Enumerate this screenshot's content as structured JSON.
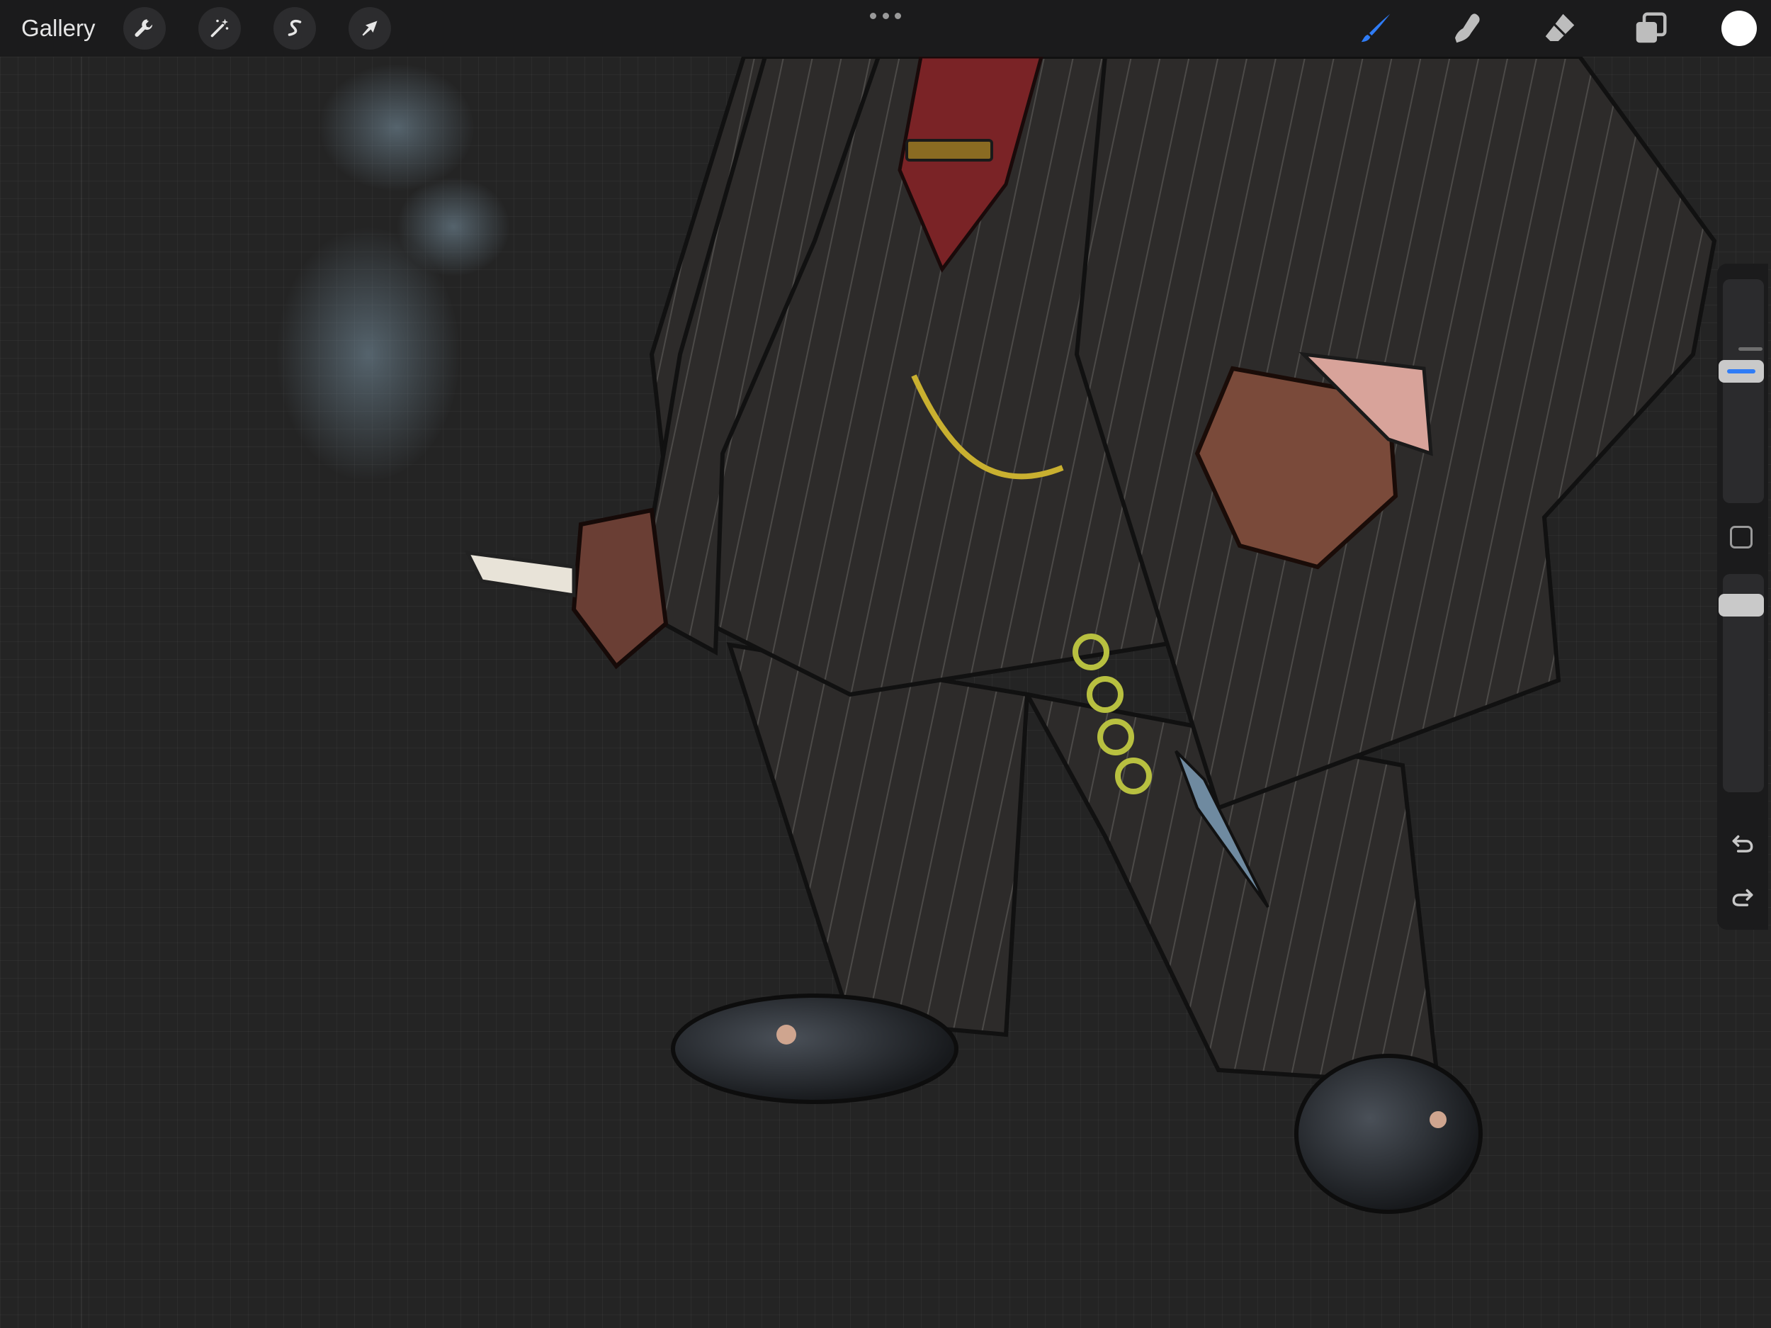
{
  "topbar": {
    "gallery_label": "Gallery",
    "left_tools": [
      {
        "name": "actions",
        "icon": "wrench-icon"
      },
      {
        "name": "adjustments",
        "icon": "magic-wand-icon"
      },
      {
        "name": "selection",
        "icon": "selection-s-icon"
      },
      {
        "name": "transform",
        "icon": "arrow-cursor-icon"
      }
    ],
    "more_menu_icon": "ellipsis-icon",
    "right_tools": [
      {
        "name": "brush",
        "icon": "brush-icon",
        "active": true
      },
      {
        "name": "smudge",
        "icon": "smudge-finger-icon",
        "active": false
      },
      {
        "name": "eraser",
        "icon": "eraser-icon",
        "active": false
      },
      {
        "name": "layers",
        "icon": "layers-icon",
        "active": false
      }
    ],
    "current_color": "#ffffff"
  },
  "sidebar": {
    "brush_size_level": 0.38,
    "opacity_level": 0.1,
    "modify_icon": "square-outline-icon",
    "undo_icon": "undo-arrow-icon",
    "redo_icon": "redo-arrow-icon"
  },
  "colors": {
    "accent": "#2f7cf6",
    "toolbar_bg": "#1b1b1c",
    "canvas_bg": "#242424"
  }
}
